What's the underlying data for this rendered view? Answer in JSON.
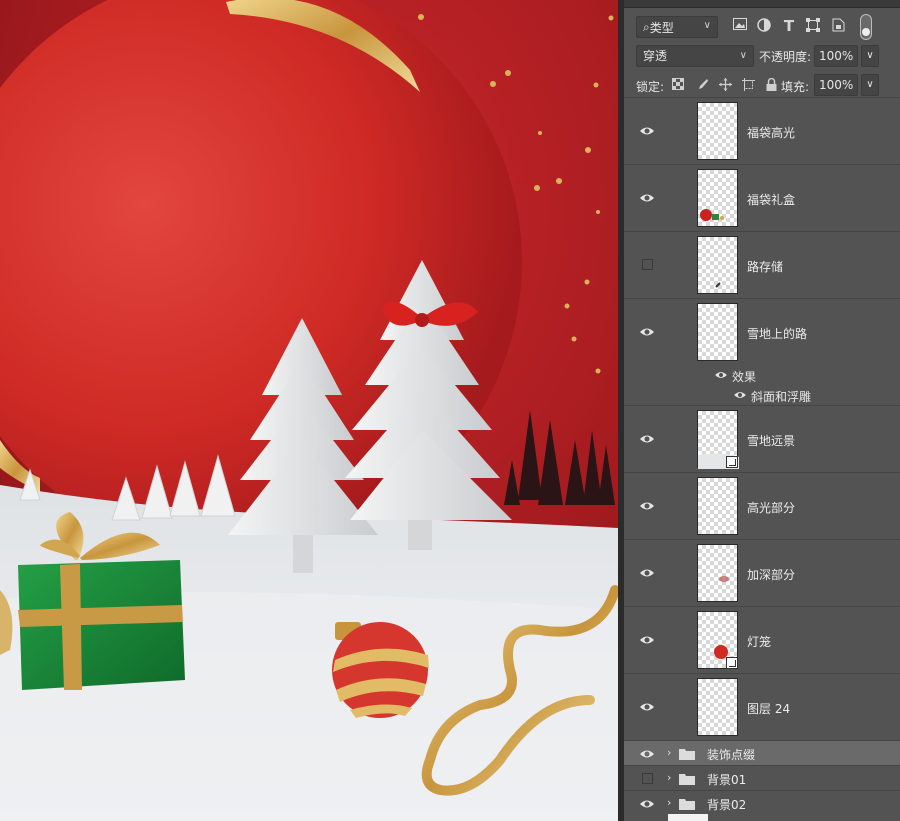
{
  "layers_panel": {
    "filter": {
      "label": "类型",
      "search_glyph": "⌕"
    },
    "filter_icons": [
      "image-filter-icon",
      "adjustment-filter-icon",
      "type-filter-icon",
      "shape-filter-icon",
      "smartobject-filter-icon"
    ],
    "type_glyph": "T",
    "blend_mode": "穿透",
    "opacity_label": "不透明度:",
    "opacity_value": "100%",
    "lock_label": "锁定:",
    "fill_label": "填充:",
    "fill_value": "100%",
    "dropdown_glyph": "∨",
    "layers": [
      {
        "name": "福袋高光",
        "visible": true,
        "smart": false,
        "thumb": "blank"
      },
      {
        "name": "福袋礼盒",
        "visible": true,
        "smart": false,
        "thumb": "gift"
      },
      {
        "name": "路存储",
        "visible": false,
        "smart": false,
        "thumb": "stroke"
      },
      {
        "name": "雪地上的路",
        "visible": true,
        "smart": false,
        "thumb": "blank",
        "effects_label": "效果",
        "effects": [
          "斜面和浮雕"
        ]
      },
      {
        "name": "雪地远景",
        "visible": true,
        "smart": true,
        "thumb": "snow"
      },
      {
        "name": "高光部分",
        "visible": true,
        "smart": false,
        "thumb": "blank"
      },
      {
        "name": "加深部分",
        "visible": true,
        "smart": false,
        "thumb": "blot"
      },
      {
        "name": "灯笼",
        "visible": true,
        "smart": true,
        "thumb": "ornament"
      },
      {
        "name": "图层 24",
        "visible": true,
        "smart": false,
        "thumb": "blank"
      }
    ],
    "groups": [
      {
        "name": "装饰点缀",
        "visible": true,
        "selected": true
      },
      {
        "name": "背景01",
        "visible": false,
        "selected": false
      },
      {
        "name": "背景02",
        "visible": true,
        "selected": false
      }
    ]
  },
  "colors": {
    "panel_bg": "#535353",
    "canvas_red": "#b81f24",
    "ornament_red": "#d42a25",
    "gold": "#d6aa4e",
    "gift_green": "#1d8a3a",
    "snow": "#eef0f2"
  }
}
